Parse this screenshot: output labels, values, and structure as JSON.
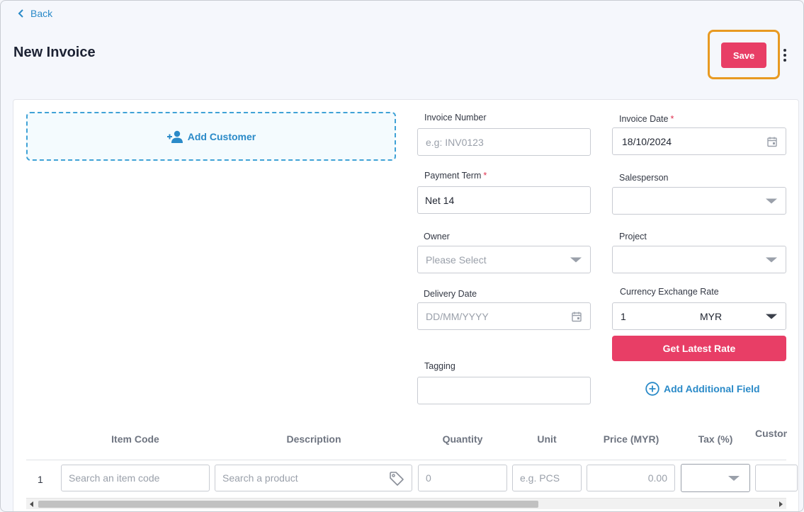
{
  "nav": {
    "back_label": "Back"
  },
  "page": {
    "title": "New Invoice"
  },
  "toolbar": {
    "save_label": "Save"
  },
  "customer": {
    "add_label": "Add Customer"
  },
  "form": {
    "invoice_number": {
      "label": "Invoice Number",
      "placeholder": "e.g: INV0123",
      "value": ""
    },
    "invoice_date": {
      "label": "Invoice Date",
      "required": "*",
      "value": "18/10/2024"
    },
    "payment_term": {
      "label": "Payment Term",
      "required": "*",
      "value": "Net 14"
    },
    "salesperson": {
      "label": "Salesperson",
      "value": ""
    },
    "owner": {
      "label": "Owner",
      "placeholder": "Please Select"
    },
    "project": {
      "label": "Project",
      "value": ""
    },
    "delivery_date": {
      "label": "Delivery Date",
      "placeholder": "DD/MM/YYYY"
    },
    "currency": {
      "label": "Currency Exchange Rate",
      "rate": "1",
      "code": "MYR"
    },
    "get_rate_label": "Get Latest Rate",
    "tagging": {
      "label": "Tagging",
      "value": ""
    },
    "add_field_label": "Add Additional Field"
  },
  "items_table": {
    "columns": [
      "Item Code",
      "Description",
      "Quantity",
      "Unit",
      "Price (MYR)",
      "Tax (%)",
      "Custom Column"
    ],
    "row": {
      "number": "1",
      "item_code_placeholder": "Search an item code",
      "description_placeholder": "Search a product",
      "quantity_placeholder": "0",
      "unit_placeholder": "e.g. PCS",
      "price_placeholder": "0.00"
    }
  },
  "colors": {
    "accent": "#e83e66",
    "link": "#2a8ac8",
    "highlight": "#e89a22"
  }
}
